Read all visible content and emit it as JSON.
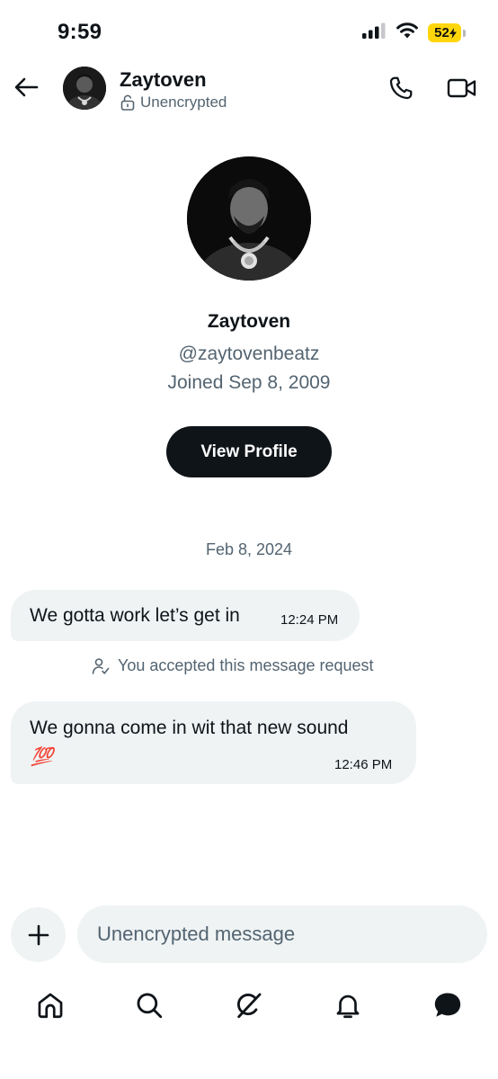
{
  "status_bar": {
    "time": "9:59",
    "battery": "52",
    "battery_color": "#ffd60a"
  },
  "header": {
    "name": "Zaytoven",
    "encryption_status": "Unencrypted",
    "icons": [
      "back-arrow-icon",
      "lock-open-icon",
      "phone-icon",
      "video-camera-icon"
    ]
  },
  "profile": {
    "name": "Zaytoven",
    "handle": "@zaytovenbeatz",
    "joined": "Joined Sep 8, 2009",
    "view_profile_label": "View Profile"
  },
  "conversation": {
    "date": "Feb 8, 2024",
    "messages": [
      {
        "text": "We gotta work let’s get in",
        "time": "12:24 PM"
      },
      {
        "text": "We gonna come in wit that new sound",
        "emoji": "💯",
        "time": "12:46 PM"
      }
    ],
    "request_note": "You accepted this message request"
  },
  "composer": {
    "placeholder": "Unencrypted message"
  },
  "tab_bar": {
    "items": [
      "home-icon",
      "search-icon",
      "grok-icon",
      "notifications-icon",
      "messages-icon"
    ],
    "active": "messages-icon"
  },
  "colors": {
    "text": "#0f1419",
    "secondary_text": "#536471",
    "bubble": "#eff3f4",
    "button_dark": "#0f1419"
  }
}
